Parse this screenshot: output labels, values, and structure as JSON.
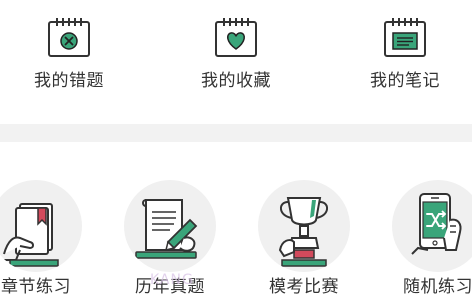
{
  "quick_links": [
    {
      "label": "我的错题",
      "icon": "calendar-x-icon"
    },
    {
      "label": "我的收藏",
      "icon": "calendar-heart-icon"
    },
    {
      "label": "我的笔记",
      "icon": "calendar-note-icon"
    }
  ],
  "modules": [
    {
      "label": "章节练习",
      "icon": "book-bookmark-icon"
    },
    {
      "label": "历年真题",
      "icon": "scroll-pen-icon"
    },
    {
      "label": "模考比赛",
      "icon": "trophy-icon"
    },
    {
      "label": "随机练习",
      "icon": "phone-shuffle-icon"
    }
  ],
  "colors": {
    "accent_green": "#3aa57a",
    "divider": "#f2f2f2",
    "text": "#333333",
    "disc": "#f0f0f0"
  },
  "watermark": "KANG"
}
